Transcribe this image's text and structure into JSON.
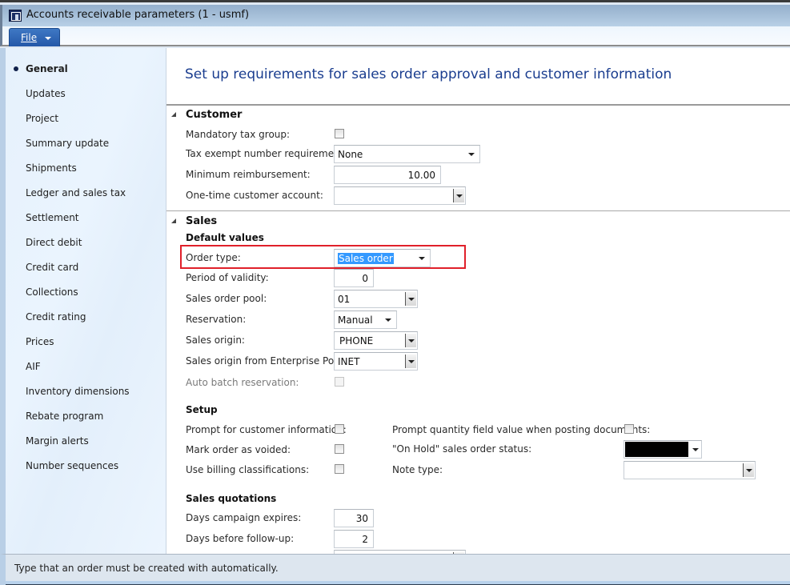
{
  "window": {
    "title": "Accounts receivable parameters (1 - usmf)",
    "app_icon": "dynamics-ax-icon"
  },
  "ribbon": {
    "file_label": "File",
    "file_caret_icon": "chevron-down-icon"
  },
  "sidebar": {
    "items": [
      {
        "label": "General",
        "active": true
      },
      {
        "label": "Updates"
      },
      {
        "label": "Project"
      },
      {
        "label": "Summary update"
      },
      {
        "label": "Shipments"
      },
      {
        "label": "Ledger and sales tax"
      },
      {
        "label": "Settlement"
      },
      {
        "label": "Direct debit"
      },
      {
        "label": "Credit card"
      },
      {
        "label": "Collections"
      },
      {
        "label": "Credit rating"
      },
      {
        "label": "Prices"
      },
      {
        "label": "AIF"
      },
      {
        "label": "Inventory dimensions"
      },
      {
        "label": "Rebate program"
      },
      {
        "label": "Margin alerts"
      },
      {
        "label": "Number sequences"
      }
    ]
  },
  "main": {
    "header": "Set up requirements for sales order approval and customer information",
    "customer": {
      "title": "Customer",
      "mandatory_tax_group": {
        "label": "Mandatory tax group:",
        "checked": false
      },
      "tax_exempt": {
        "label": "Tax exempt number requirement:",
        "value": "None"
      },
      "min_reimbursement": {
        "label": "Minimum reimbursement:",
        "value": "10.00"
      },
      "one_time_account": {
        "label": "One-time customer account:",
        "value": ""
      }
    },
    "sales": {
      "title": "Sales",
      "default_values": {
        "title": "Default values",
        "order_type": {
          "label": "Order type:",
          "value": "Sales order"
        },
        "period_of_validity": {
          "label": "Period of validity:",
          "value": "0"
        },
        "sales_order_pool": {
          "label": "Sales order pool:",
          "value": "01"
        },
        "reservation": {
          "label": "Reservation:",
          "value": "Manual"
        },
        "sales_origin": {
          "label": "Sales origin:",
          "value": "PHONE"
        },
        "sales_origin_ep": {
          "label": "Sales origin from Enterprise Portal:",
          "value": "INET"
        },
        "auto_batch_reservation": {
          "label": "Auto batch reservation:",
          "checked": false,
          "disabled": true
        }
      },
      "setup": {
        "title": "Setup",
        "prompt_customer_info": {
          "label": "Prompt for customer information:",
          "checked": false
        },
        "mark_order_voided": {
          "label": "Mark order as voided:",
          "checked": false
        },
        "use_billing_classifications": {
          "label": "Use billing classifications:",
          "checked": false
        },
        "prompt_quantity": {
          "label": "Prompt quantity field value when posting documents:",
          "checked": false
        },
        "on_hold_status": {
          "label": "\"On Hold\" sales order status:",
          "value": "",
          "redacted": true
        },
        "note_type": {
          "label": "Note type:",
          "value": ""
        }
      },
      "quotations": {
        "title": "Sales quotations",
        "days_campaign_expires": {
          "label": "Days campaign expires:",
          "value": "30"
        },
        "days_before_followup": {
          "label": "Days before follow-up:",
          "value": "2"
        }
      }
    }
  },
  "status": {
    "text": "Type that an order must be created with automatically."
  },
  "colors": {
    "header_text": "#1a3d8f",
    "highlight_box": "#e0202a",
    "selection": "#3399ff",
    "file_button": "#2f66b6"
  }
}
